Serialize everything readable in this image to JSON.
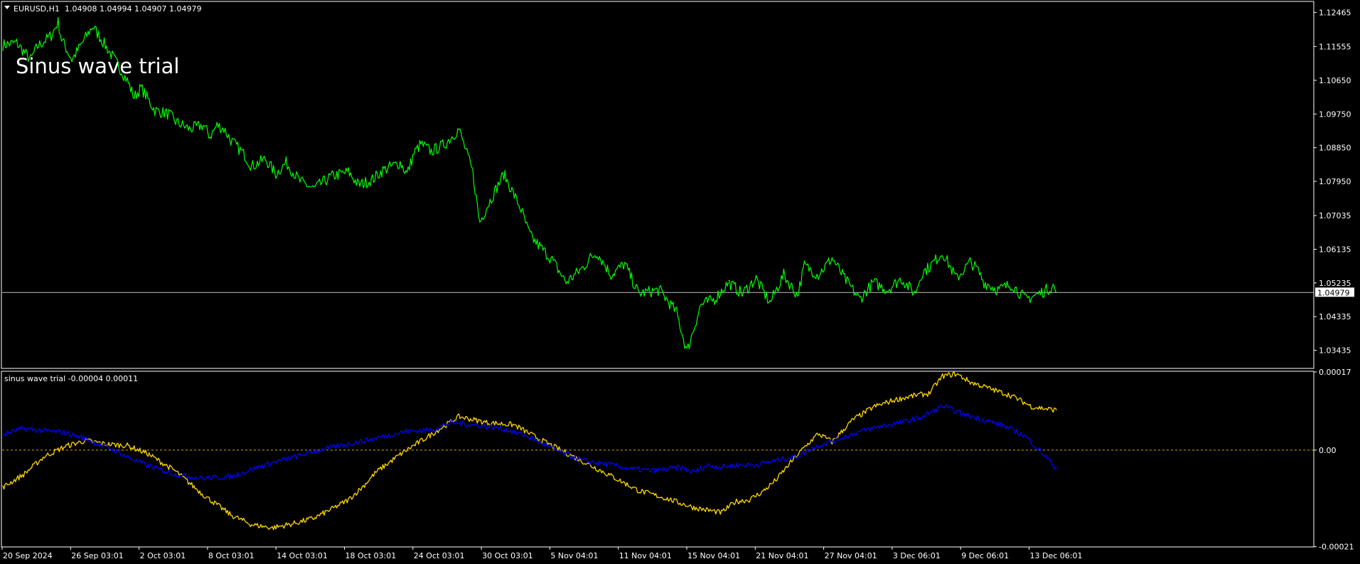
{
  "header": {
    "symbol": "EURUSD,H1",
    "ohlc": "1.04908 1.04994 1.04907 1.04979"
  },
  "annotation": "Sinus wave trial",
  "indicator_label": "sinus wave trial -0.00004 0.00011",
  "colors": {
    "background": "#000000",
    "frame": "#ffffff",
    "price_line": "#00ff00",
    "sine_line": "#ffd700",
    "signal_line": "#0000ff",
    "zero_line": "#daa520",
    "bid_line": "#c0c0c0"
  },
  "icons": {
    "menu": "triangle-down-icon"
  },
  "chart_data": [
    {
      "type": "line",
      "title": "EURUSD,H1",
      "ylim": [
        1.0297,
        1.1274
      ],
      "y_ticks": [
        "1.12465",
        "1.11555",
        "1.10650",
        "1.09750",
        "1.08850",
        "1.07950",
        "1.07035",
        "1.06135",
        "1.05235",
        "1.04335",
        "1.03435"
      ],
      "current_price": "1.04979",
      "series": [
        {
          "x": [
            0,
            4,
            8,
            10,
            14,
            16,
            17,
            20,
            24,
            26,
            32,
            36,
            38,
            40,
            44,
            48,
            50,
            54,
            58,
            60,
            62,
            64,
            66,
            70,
            72,
            76,
            79,
            82,
            86,
            90,
            95,
            100,
            103,
            107,
            110,
            115,
            117,
            119,
            121,
            124,
            128,
            132,
            136,
            138,
            140,
            145,
            150,
            152,
            153,
            156,
            159,
            163,
            168,
            170,
            172,
            176,
            180,
            184,
            190,
            195,
            198,
            202,
            206,
            210
          ],
          "values": [
            1.116,
            1.1165,
            1.112,
            1.1155,
            1.1185,
            1.122,
            1.1175,
            1.112,
            1.118,
            1.121,
            1.1125,
            1.1065,
            1.102,
            1.1045,
            1.0985,
            1.0975,
            1.0955,
            1.0935,
            1.0945,
            1.0915,
            1.0945,
            1.0935,
            1.0905,
            1.0865,
            1.0835,
            1.0855,
            1.0815,
            1.0845,
            1.0795,
            1.0775,
            1.0808,
            1.082,
            1.0785,
            1.08,
            1.0825,
            1.0845,
            1.0815,
            1.087,
            1.0895,
            1.0875,
            1.0895,
            1.0935,
            1.082,
            1.0685,
            1.0725,
            1.0815,
            1.072,
            1.0665,
            1.0645,
            1.0615,
            1.0585,
            1.0525,
            1.0565,
            1.059,
            1.0605,
            1.0545,
            1.0575,
            1.0495,
            1.0505,
            1.0445,
            1.034,
            1.0465,
            1.048,
            1.0525
          ]
        },
        {
          "x": [
            210,
            214,
            218,
            222,
            226,
            230,
            232,
            236,
            240,
            244,
            248,
            252,
            256,
            260,
            264,
            266,
            268,
            272,
            276,
            280,
            282,
            284,
            288,
            292,
            296,
            300,
            304,
            305
          ],
          "values": [
            1.0525,
            1.0495,
            1.0535,
            1.047,
            1.0545,
            1.049,
            1.057,
            1.0545,
            1.059,
            1.053,
            1.048,
            1.0525,
            1.0505,
            1.0535,
            1.0495,
            1.055,
            1.0565,
            1.0605,
            1.0535,
            1.058,
            1.056,
            1.0525,
            1.0505,
            1.052,
            1.048,
            1.0495,
            1.0515,
            1.0498
          ]
        }
      ]
    },
    {
      "type": "line",
      "title": "sinus wave trial",
      "ylim": [
        -0.000209,
        0.00017
      ],
      "y_ticks": [
        "0.00017",
        "0.00",
        "-0.00021"
      ],
      "zero_line": 0,
      "series": [
        {
          "color": "yellow",
          "x": [
            0,
            6,
            12,
            18,
            24,
            30,
            36,
            42,
            50,
            58,
            66,
            72,
            78,
            84,
            90,
            96,
            100,
            104,
            108,
            116,
            124,
            132,
            140,
            148,
            156,
            162,
            168,
            176,
            184,
            192,
            200,
            208,
            212,
            216,
            220,
            224,
            228,
            232,
            236,
            240,
            246,
            252,
            258,
            264,
            268,
            272,
            276,
            280,
            286,
            292,
            298,
            305
          ],
          "values": [
            -8.1e-05,
            -5.3e-05,
            -1.4e-05,
            8e-06,
            2.1e-05,
            1.3e-05,
            1e-05,
            -8e-06,
            -4.6e-05,
            -9.7e-05,
            -0.000141,
            -0.000162,
            -0.000169,
            -0.00016,
            -0.000148,
            -0.000125,
            -0.000108,
            -8.1e-05,
            -4.8e-05,
            -4e-06,
            3.4e-05,
            7.3e-05,
            6e-05,
            5.5e-05,
            2.1e-05,
            -2e-06,
            -2.5e-05,
            -5.6e-05,
            -8.8e-05,
            -0.000105,
            -0.000125,
            -0.000136,
            -0.000112,
            -0.000108,
            -9e-05,
            -6.3e-05,
            -2.7e-05,
            6e-06,
            3.6e-05,
            1.8e-05,
            6.6e-05,
            9.4e-05,
            0.000109,
            0.000119,
            0.000123,
            0.000161,
            0.000166,
            0.000148,
            0.000133,
            0.000118,
            9.4e-05,
            8.7e-05
          ]
        },
        {
          "color": "blue",
          "x": [
            0,
            6,
            12,
            18,
            24,
            28,
            32,
            36,
            42,
            50,
            58,
            66,
            72,
            78,
            84,
            92,
            100,
            108,
            116,
            124,
            130,
            136,
            144,
            152,
            160,
            168,
            176,
            182,
            188,
            196,
            200,
            204,
            208,
            212,
            218,
            224,
            230,
            236,
            242,
            248,
            254,
            260,
            266,
            272,
            278,
            284,
            290,
            296,
            302,
            305
          ],
          "values": [
            3.4e-05,
            4.7e-05,
            4.2e-05,
            3.8e-05,
            2.5e-05,
            1.2e-05,
            1e-06,
            -1.5e-05,
            -3.4e-05,
            -5.3e-05,
            -6.1e-05,
            -5.8e-05,
            -4.2e-05,
            -2.7e-05,
            -1.6e-05,
            1e-06,
            1.3e-05,
            2.6e-05,
            4e-05,
            4.4e-05,
            6e-05,
            5.5e-05,
            4.8e-05,
            3e-05,
            0.0,
            -2.3e-05,
            -3.2e-05,
            -4.1e-05,
            -4.5e-05,
            -3.8e-05,
            -4.8e-05,
            -3.3e-05,
            -3.7e-05,
            -3.3e-05,
            -3.2e-05,
            -2.2e-05,
            -1.3e-05,
            1e-05,
            2.5e-05,
            4e-05,
            5.2e-05,
            6e-05,
            7.2e-05,
            9.6e-05,
            7.8e-05,
            6.6e-05,
            5.2e-05,
            3e-05,
            -1.5e-05,
            -4.1e-05
          ]
        }
      ]
    }
  ],
  "x_axis_labels": [
    "20 Sep 2024",
    "26 Sep 03:01",
    "2 Oct 03:01",
    "8 Oct 03:01",
    "14 Oct 03:01",
    "18 Oct 03:01",
    "24 Oct 03:01",
    "30 Oct 03:01",
    "5 Nov 04:01",
    "11 Nov 04:01",
    "15 Nov 04:01",
    "21 Nov 04:01",
    "27 Nov 04:01",
    "3 Dec 06:01",
    "9 Dec 06:01",
    "13 Dec 06:01"
  ]
}
